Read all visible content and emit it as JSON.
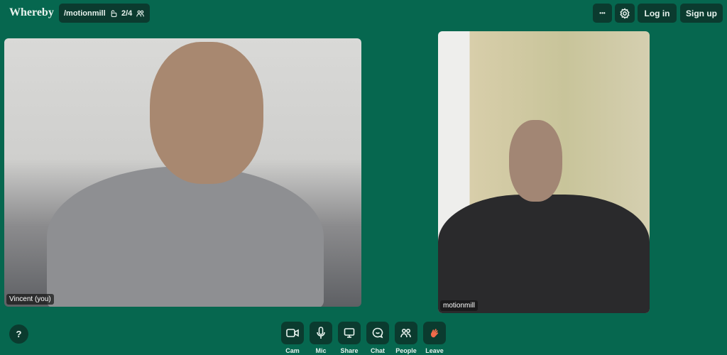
{
  "header": {
    "logo": "Whereby",
    "room": "/motionmill",
    "participants": "2/4",
    "more": "•••",
    "login": "Log in",
    "signup": "Sign up"
  },
  "tiles": [
    {
      "name": "Vincent (you)"
    },
    {
      "name": "motionmill"
    }
  ],
  "help": "?",
  "toolbar": [
    {
      "label": "Cam",
      "icon": "camera-icon"
    },
    {
      "label": "Mic",
      "icon": "mic-icon"
    },
    {
      "label": "Share",
      "icon": "screen-share-icon"
    },
    {
      "label": "Chat",
      "icon": "chat-icon"
    },
    {
      "label": "People",
      "icon": "people-icon"
    },
    {
      "label": "Leave",
      "icon": "wave-hand-icon"
    }
  ],
  "colors": {
    "background": "#06674f",
    "button": "#0b3b2f",
    "leave": "#f26b4a"
  }
}
